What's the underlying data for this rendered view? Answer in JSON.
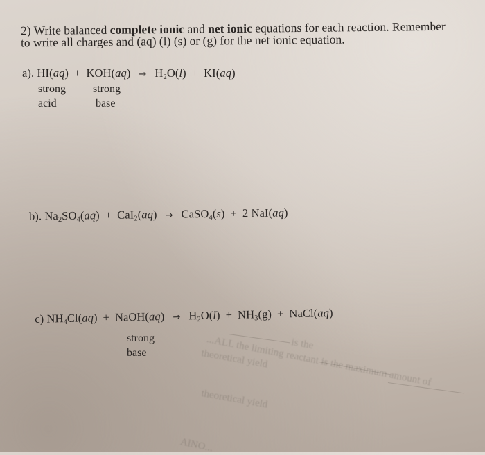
{
  "question": {
    "number": "2)",
    "line1_prefix": "Write balanced ",
    "bold1": "complete ionic",
    "line1_mid": " and ",
    "bold2": "net ionic",
    "line1_suffix": " equations for each reaction. Remember",
    "line2": "to write all charges and (aq) (l) (s) or (g) for the net ionic equation."
  },
  "reactions": {
    "a": {
      "label": "a).",
      "reactant1": {
        "formula": "HI",
        "state": "aq"
      },
      "plus1": "+",
      "reactant2": {
        "formula": "KOH",
        "state": "aq"
      },
      "arrow": "→",
      "product1": {
        "formula_main": "H",
        "sub": "2",
        "formula_rest": "O",
        "state": "l"
      },
      "plus2": "+",
      "product2": {
        "formula": "KI",
        "state": "aq"
      },
      "note1": {
        "line1": "strong",
        "line2": "acid"
      },
      "note2": {
        "line1": "strong",
        "line2": "base"
      }
    },
    "b": {
      "label": "b).",
      "reactant1": {
        "p1": "Na",
        "s1": "2",
        "p2": "SO",
        "s2": "4",
        "state": "aq"
      },
      "plus1": "+",
      "reactant2": {
        "p1": "CaI",
        "s1": "2",
        "state": "aq"
      },
      "arrow": "→",
      "product1": {
        "p1": "CaSO",
        "s1": "4",
        "state": "s"
      },
      "plus2": "+",
      "product2": {
        "coef": "2",
        "formula": "NaI",
        "state": "aq"
      }
    },
    "c": {
      "label": "c)",
      "reactant1": {
        "p1": "NH",
        "s1": "4",
        "p2": "Cl",
        "state": "aq"
      },
      "plus1": "+",
      "reactant2": {
        "formula": "NaOH",
        "state": "aq"
      },
      "arrow": "→",
      "product1": {
        "p1": "H",
        "s1": "2",
        "p2": "O",
        "state": "l"
      },
      "plus2": "+",
      "product3": {
        "p1": "NH",
        "s1": "3",
        "state": "g"
      },
      "plus3": "+",
      "product2": {
        "formula": "NaCl",
        "state": "aq"
      },
      "note": {
        "line1": "strong",
        "line2": "base"
      }
    }
  },
  "bleed_through": {
    "line1": "...ALL the limiting reactant is the maximum amount of",
    "line2": "theoretical yield",
    "line3": "is the",
    "line4": "theoretical yield",
    "line5": "AlNO..."
  }
}
